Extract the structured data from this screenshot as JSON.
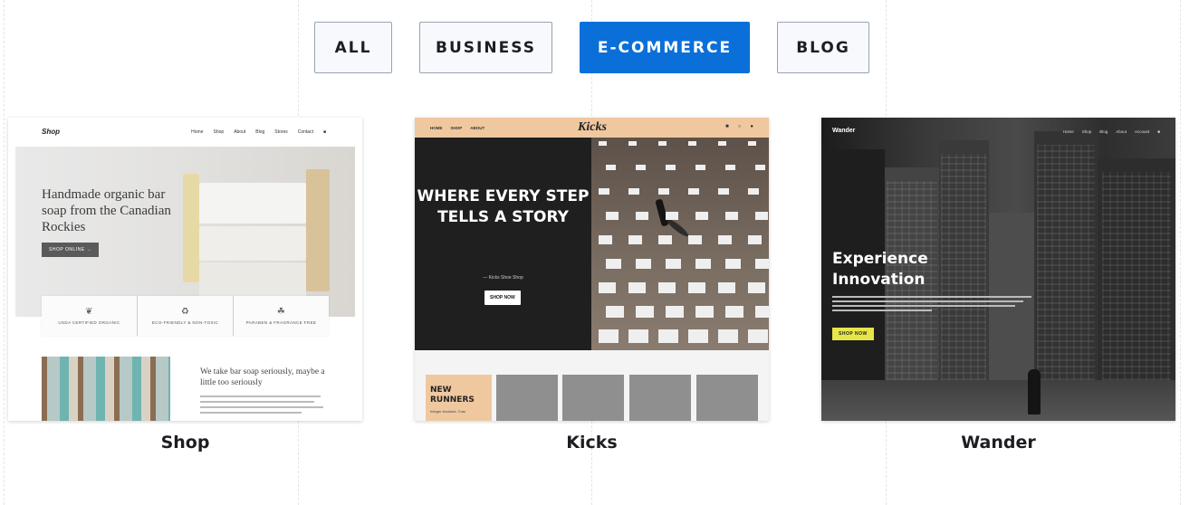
{
  "filters": [
    {
      "label": "ALL",
      "active": false
    },
    {
      "label": "BUSINESS",
      "active": false
    },
    {
      "label": "E-COMMERCE",
      "active": true
    },
    {
      "label": "BLOG",
      "active": false
    }
  ],
  "colors": {
    "accent": "#0a6fd9",
    "kicks_peach": "#f0c8a0",
    "wander_yellow": "#e8e54a"
  },
  "templates": [
    {
      "caption": "Shop",
      "logo": "Shop",
      "nav": [
        "Home",
        "Shop",
        "About",
        "Blog",
        "Stores",
        "Contact"
      ],
      "hero_title": "Handmade organic bar soap from the Canadian Rockies",
      "hero_cta": "SHOP ONLINE →",
      "badges": [
        "USDA CERTIFIED ORGANIC",
        "ECO-FRIENDLY & NON-TOXIC",
        "PARABEN & FRAGRANCE FREE"
      ],
      "intro": "We take bar soap seriously, maybe a little too seriously"
    },
    {
      "caption": "Kicks",
      "logo": "Kicks",
      "nav": [
        "HOME",
        "SHOP",
        "ABOUT"
      ],
      "hero_title": "WHERE EVERY STEP TELLS A STORY",
      "tagline": "— Kicks Shoe Shop",
      "hero_cta": "SHOP NOW",
      "section_title": "NEW RUNNERS",
      "section_text": "Integer tincidunt. Cras"
    },
    {
      "caption": "Wander",
      "logo": "Wander",
      "nav": [
        "Home",
        "Shop",
        "Blog",
        "About",
        "Account"
      ],
      "hero_title": "Experience Innovation",
      "hero_cta": "SHOP NOW"
    }
  ]
}
